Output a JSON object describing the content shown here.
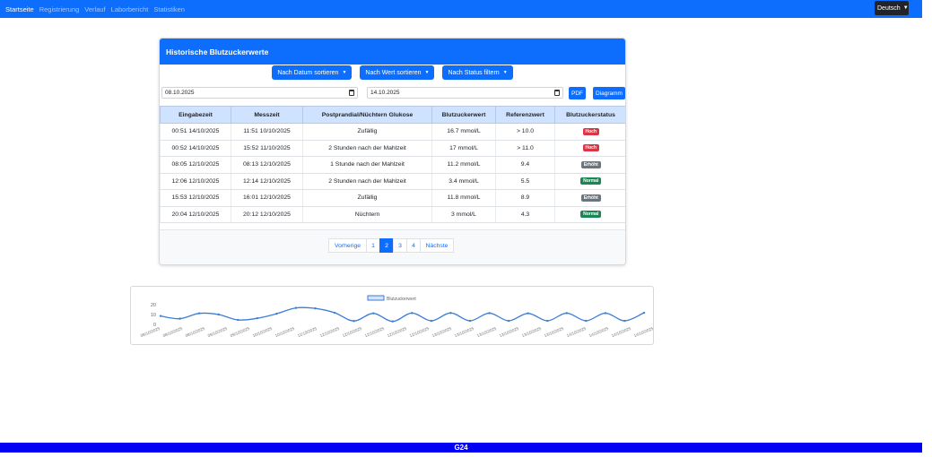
{
  "navbar": {
    "links": [
      "Startseite",
      "Registrierung",
      "Verlauf",
      "Laborbericht",
      "Statistiken"
    ],
    "active_index": 0,
    "language": "Deutsch"
  },
  "card": {
    "title": "Historische Blutzuckerwerte",
    "filters": [
      "Nach Datum sortieren",
      "Nach Wert sortieren",
      "Nach Status filtern"
    ],
    "date_from": "08.10.2025",
    "date_to": "14.10.2025",
    "pdf_label": "PDF",
    "chart_label": "Diagramm"
  },
  "table": {
    "headers": [
      "Eingabezeit",
      "Messzeit",
      "Postprandial/Nüchtern Glukose",
      "Blutzuckerwert",
      "Referenzwert",
      "Blutzuckerstatus"
    ],
    "rows": [
      [
        "00:51 14/10/2025",
        "11:51 10/10/2025",
        "Zufällig",
        "16.7 mmol/L",
        "> 10.0",
        "Hoch"
      ],
      [
        "00:52 14/10/2025",
        "15:52 11/10/2025",
        "2 Stunden nach der Mahlzeit",
        "17 mmol/L",
        "> 11.0",
        "Hoch"
      ],
      [
        "08:05 12/10/2025",
        "08:13 12/10/2025",
        "1 Stunde nach der Mahlzeit",
        "11.2 mmol/L",
        "9.4",
        "Erhöht"
      ],
      [
        "12:06 12/10/2025",
        "12:14 12/10/2025",
        "2 Stunden nach der Mahlzeit",
        "3.4 mmol/L",
        "5.5",
        "Normal"
      ],
      [
        "15:53 12/10/2025",
        "16:01 12/10/2025",
        "Zufällig",
        "11.8 mmol/L",
        "8.9",
        "Erhöht"
      ],
      [
        "20:04 12/10/2025",
        "20:12 12/10/2025",
        "Nüchtern",
        "3 mmol/L",
        "4.3",
        "Normal"
      ]
    ],
    "status_colors": {
      "Hoch": "#dc3545",
      "Erhöht": "#6c757d",
      "Normal": "#198754"
    }
  },
  "pagination": {
    "items": [
      "Vorherige",
      "1",
      "2",
      "3",
      "4",
      "Nächste"
    ],
    "active": "2"
  },
  "chart_data": {
    "type": "line",
    "series": [
      {
        "name": "Blutzuckerwert",
        "color": "#3b7dd8",
        "values": [
          8.5,
          5.8,
          11.2,
          10.0,
          4.5,
          6.2,
          10.8,
          16.7,
          16.2,
          11.8,
          3.4,
          11.2,
          3.0,
          11.5,
          3.6,
          11.6,
          3.6,
          11.4,
          3.6,
          11.2,
          3.6,
          11.4,
          3.6,
          11.4,
          3.6,
          11.8
        ]
      }
    ],
    "x_tick_labels": [
      "08/10/2025",
      "08/10/2025",
      "08/10/2025",
      "09/10/2025",
      "09/10/2025",
      "10/10/2025",
      "10/10/2025",
      "11/10/2025",
      "12/10/2025",
      "12/10/2025",
      "12/10/2025",
      "12/10/2025",
      "12/10/2025",
      "13/10/2025",
      "13/10/2025",
      "13/10/2025",
      "13/10/2025",
      "13/10/2025",
      "13/10/2025",
      "14/10/2025",
      "14/10/2025",
      "14/10/2025",
      "14/10/2025"
    ],
    "y_ticks": [
      0,
      10,
      20
    ],
    "ylim": [
      0,
      20
    ],
    "legend": "top-center",
    "grid": false
  },
  "footer": {
    "text": "G24"
  }
}
